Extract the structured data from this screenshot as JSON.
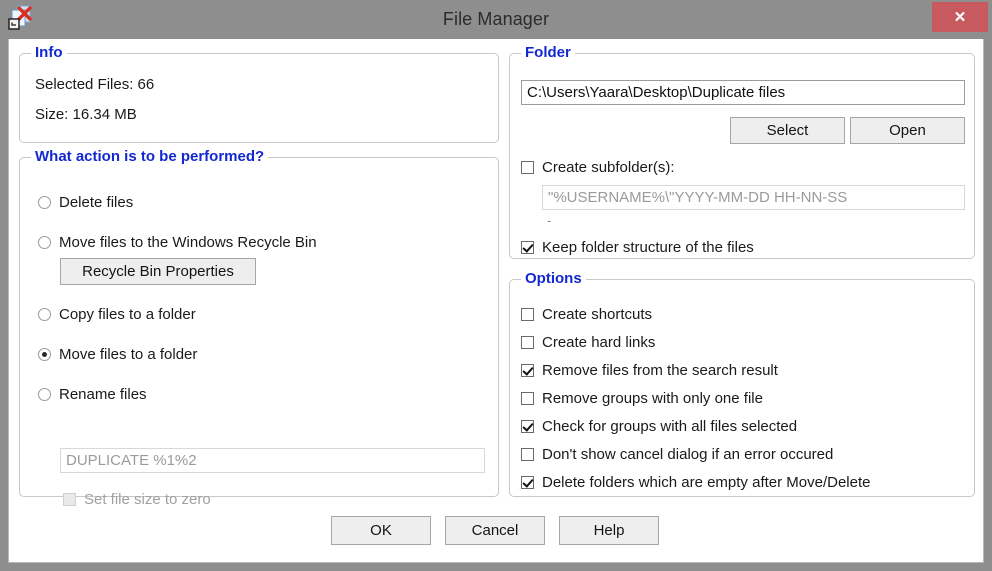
{
  "window": {
    "title": "File Manager",
    "icon": "file-delete-icon",
    "close_label": "✕",
    "titlebar_color": "#8e8e8e",
    "close_color": "#c75a5f",
    "accent_color": "#1428d2"
  },
  "info": {
    "legend": "Info",
    "selected_files_label": "Selected Files: 66",
    "size_label": "Size: 16.34 MB"
  },
  "action": {
    "legend": "What action is to be performed?",
    "options": [
      {
        "label": "Delete files",
        "checked": false
      },
      {
        "label": "Move files to the Windows Recycle Bin",
        "checked": false
      },
      {
        "label": "Copy files to a folder",
        "checked": false
      },
      {
        "label": "Move files to a folder",
        "checked": true
      },
      {
        "label": "Rename files",
        "checked": false
      }
    ],
    "recycle_bin_button": "Recycle Bin Properties",
    "rename_pattern": "DUPLICATE %1%2",
    "set_file_size_zero": {
      "label": "Set file size to zero",
      "checked": false,
      "disabled": true
    }
  },
  "folder": {
    "legend": "Folder",
    "path": "C:\\Users\\Yaara\\Desktop\\Duplicate files",
    "select_button": "Select",
    "open_button": "Open",
    "create_subfolders": {
      "label": "Create subfolder(s):",
      "checked": false
    },
    "subfolder_pattern": "\"%USERNAME%\\\"YYYY-MM-DD HH-NN-SS",
    "separator": "-",
    "keep_structure": {
      "label": "Keep folder structure of the files",
      "checked": true
    }
  },
  "options": {
    "legend": "Options",
    "items": [
      {
        "label": "Create shortcuts",
        "checked": false
      },
      {
        "label": "Create hard links",
        "checked": false
      },
      {
        "label": "Remove files from the search result",
        "checked": true
      },
      {
        "label": "Remove groups with only one file",
        "checked": false
      },
      {
        "label": "Check for groups with all files selected",
        "checked": true
      },
      {
        "label": "Don't show cancel dialog if an error occured",
        "checked": false
      },
      {
        "label": "Delete folders which are empty after Move/Delete",
        "checked": true
      }
    ]
  },
  "footer": {
    "ok": "OK",
    "cancel": "Cancel",
    "help": "Help"
  }
}
